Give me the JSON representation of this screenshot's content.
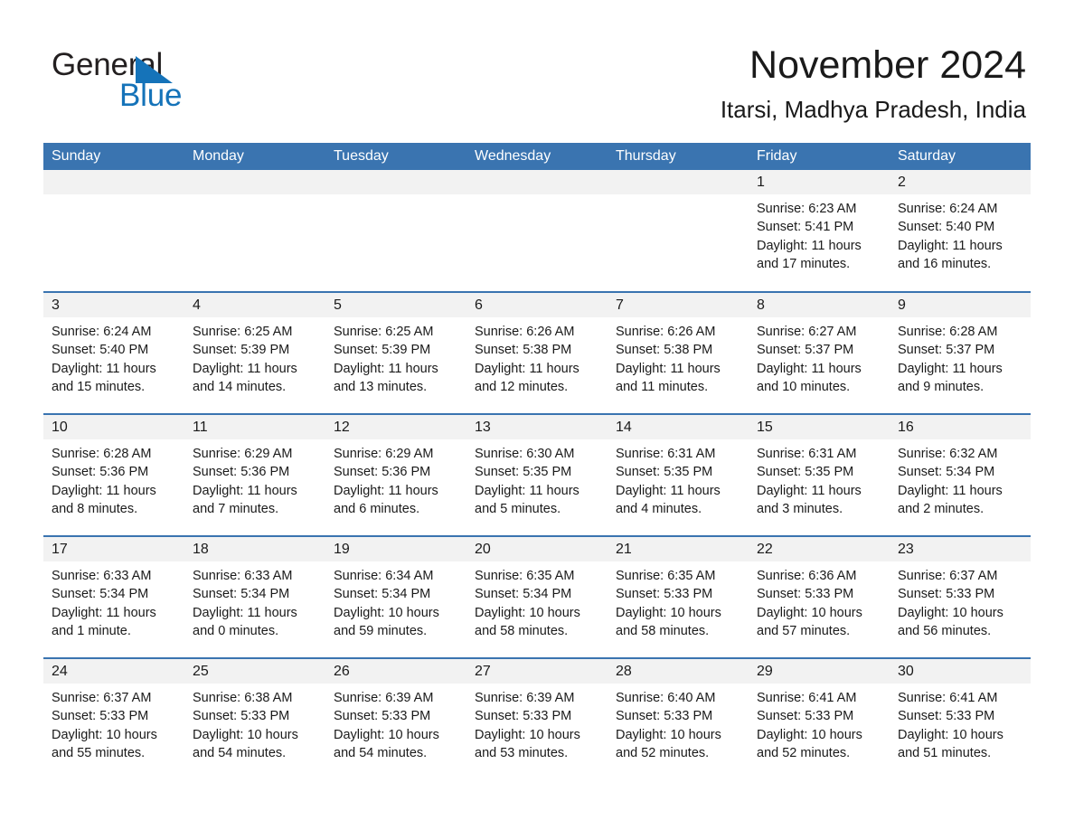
{
  "brand": {
    "line1": "General",
    "line2": "Blue",
    "triangle_color": "#1573b9",
    "text_color": "#231f20"
  },
  "header": {
    "title": "November 2024",
    "subtitle": "Itarsi, Madhya Pradesh, India"
  },
  "theme": {
    "header_bar": "#3a74b0",
    "row_divider": "#3a74b0",
    "daynum_strip": "#f2f2f2",
    "page_bg": "#ffffff",
    "text": "#1a1a1a"
  },
  "weekdays": [
    "Sunday",
    "Monday",
    "Tuesday",
    "Wednesday",
    "Thursday",
    "Friday",
    "Saturday"
  ],
  "weeks": [
    [
      {
        "day": "",
        "sunrise": "",
        "sunset": "",
        "daylight1": "",
        "daylight2": ""
      },
      {
        "day": "",
        "sunrise": "",
        "sunset": "",
        "daylight1": "",
        "daylight2": ""
      },
      {
        "day": "",
        "sunrise": "",
        "sunset": "",
        "daylight1": "",
        "daylight2": ""
      },
      {
        "day": "",
        "sunrise": "",
        "sunset": "",
        "daylight1": "",
        "daylight2": ""
      },
      {
        "day": "",
        "sunrise": "",
        "sunset": "",
        "daylight1": "",
        "daylight2": ""
      },
      {
        "day": "1",
        "sunrise": "Sunrise: 6:23 AM",
        "sunset": "Sunset: 5:41 PM",
        "daylight1": "Daylight: 11 hours",
        "daylight2": "and 17 minutes."
      },
      {
        "day": "2",
        "sunrise": "Sunrise: 6:24 AM",
        "sunset": "Sunset: 5:40 PM",
        "daylight1": "Daylight: 11 hours",
        "daylight2": "and 16 minutes."
      }
    ],
    [
      {
        "day": "3",
        "sunrise": "Sunrise: 6:24 AM",
        "sunset": "Sunset: 5:40 PM",
        "daylight1": "Daylight: 11 hours",
        "daylight2": "and 15 minutes."
      },
      {
        "day": "4",
        "sunrise": "Sunrise: 6:25 AM",
        "sunset": "Sunset: 5:39 PM",
        "daylight1": "Daylight: 11 hours",
        "daylight2": "and 14 minutes."
      },
      {
        "day": "5",
        "sunrise": "Sunrise: 6:25 AM",
        "sunset": "Sunset: 5:39 PM",
        "daylight1": "Daylight: 11 hours",
        "daylight2": "and 13 minutes."
      },
      {
        "day": "6",
        "sunrise": "Sunrise: 6:26 AM",
        "sunset": "Sunset: 5:38 PM",
        "daylight1": "Daylight: 11 hours",
        "daylight2": "and 12 minutes."
      },
      {
        "day": "7",
        "sunrise": "Sunrise: 6:26 AM",
        "sunset": "Sunset: 5:38 PM",
        "daylight1": "Daylight: 11 hours",
        "daylight2": "and 11 minutes."
      },
      {
        "day": "8",
        "sunrise": "Sunrise: 6:27 AM",
        "sunset": "Sunset: 5:37 PM",
        "daylight1": "Daylight: 11 hours",
        "daylight2": "and 10 minutes."
      },
      {
        "day": "9",
        "sunrise": "Sunrise: 6:28 AM",
        "sunset": "Sunset: 5:37 PM",
        "daylight1": "Daylight: 11 hours",
        "daylight2": "and 9 minutes."
      }
    ],
    [
      {
        "day": "10",
        "sunrise": "Sunrise: 6:28 AM",
        "sunset": "Sunset: 5:36 PM",
        "daylight1": "Daylight: 11 hours",
        "daylight2": "and 8 minutes."
      },
      {
        "day": "11",
        "sunrise": "Sunrise: 6:29 AM",
        "sunset": "Sunset: 5:36 PM",
        "daylight1": "Daylight: 11 hours",
        "daylight2": "and 7 minutes."
      },
      {
        "day": "12",
        "sunrise": "Sunrise: 6:29 AM",
        "sunset": "Sunset: 5:36 PM",
        "daylight1": "Daylight: 11 hours",
        "daylight2": "and 6 minutes."
      },
      {
        "day": "13",
        "sunrise": "Sunrise: 6:30 AM",
        "sunset": "Sunset: 5:35 PM",
        "daylight1": "Daylight: 11 hours",
        "daylight2": "and 5 minutes."
      },
      {
        "day": "14",
        "sunrise": "Sunrise: 6:31 AM",
        "sunset": "Sunset: 5:35 PM",
        "daylight1": "Daylight: 11 hours",
        "daylight2": "and 4 minutes."
      },
      {
        "day": "15",
        "sunrise": "Sunrise: 6:31 AM",
        "sunset": "Sunset: 5:35 PM",
        "daylight1": "Daylight: 11 hours",
        "daylight2": "and 3 minutes."
      },
      {
        "day": "16",
        "sunrise": "Sunrise: 6:32 AM",
        "sunset": "Sunset: 5:34 PM",
        "daylight1": "Daylight: 11 hours",
        "daylight2": "and 2 minutes."
      }
    ],
    [
      {
        "day": "17",
        "sunrise": "Sunrise: 6:33 AM",
        "sunset": "Sunset: 5:34 PM",
        "daylight1": "Daylight: 11 hours",
        "daylight2": "and 1 minute."
      },
      {
        "day": "18",
        "sunrise": "Sunrise: 6:33 AM",
        "sunset": "Sunset: 5:34 PM",
        "daylight1": "Daylight: 11 hours",
        "daylight2": "and 0 minutes."
      },
      {
        "day": "19",
        "sunrise": "Sunrise: 6:34 AM",
        "sunset": "Sunset: 5:34 PM",
        "daylight1": "Daylight: 10 hours",
        "daylight2": "and 59 minutes."
      },
      {
        "day": "20",
        "sunrise": "Sunrise: 6:35 AM",
        "sunset": "Sunset: 5:34 PM",
        "daylight1": "Daylight: 10 hours",
        "daylight2": "and 58 minutes."
      },
      {
        "day": "21",
        "sunrise": "Sunrise: 6:35 AM",
        "sunset": "Sunset: 5:33 PM",
        "daylight1": "Daylight: 10 hours",
        "daylight2": "and 58 minutes."
      },
      {
        "day": "22",
        "sunrise": "Sunrise: 6:36 AM",
        "sunset": "Sunset: 5:33 PM",
        "daylight1": "Daylight: 10 hours",
        "daylight2": "and 57 minutes."
      },
      {
        "day": "23",
        "sunrise": "Sunrise: 6:37 AM",
        "sunset": "Sunset: 5:33 PM",
        "daylight1": "Daylight: 10 hours",
        "daylight2": "and 56 minutes."
      }
    ],
    [
      {
        "day": "24",
        "sunrise": "Sunrise: 6:37 AM",
        "sunset": "Sunset: 5:33 PM",
        "daylight1": "Daylight: 10 hours",
        "daylight2": "and 55 minutes."
      },
      {
        "day": "25",
        "sunrise": "Sunrise: 6:38 AM",
        "sunset": "Sunset: 5:33 PM",
        "daylight1": "Daylight: 10 hours",
        "daylight2": "and 54 minutes."
      },
      {
        "day": "26",
        "sunrise": "Sunrise: 6:39 AM",
        "sunset": "Sunset: 5:33 PM",
        "daylight1": "Daylight: 10 hours",
        "daylight2": "and 54 minutes."
      },
      {
        "day": "27",
        "sunrise": "Sunrise: 6:39 AM",
        "sunset": "Sunset: 5:33 PM",
        "daylight1": "Daylight: 10 hours",
        "daylight2": "and 53 minutes."
      },
      {
        "day": "28",
        "sunrise": "Sunrise: 6:40 AM",
        "sunset": "Sunset: 5:33 PM",
        "daylight1": "Daylight: 10 hours",
        "daylight2": "and 52 minutes."
      },
      {
        "day": "29",
        "sunrise": "Sunrise: 6:41 AM",
        "sunset": "Sunset: 5:33 PM",
        "daylight1": "Daylight: 10 hours",
        "daylight2": "and 52 minutes."
      },
      {
        "day": "30",
        "sunrise": "Sunrise: 6:41 AM",
        "sunset": "Sunset: 5:33 PM",
        "daylight1": "Daylight: 10 hours",
        "daylight2": "and 51 minutes."
      }
    ]
  ]
}
